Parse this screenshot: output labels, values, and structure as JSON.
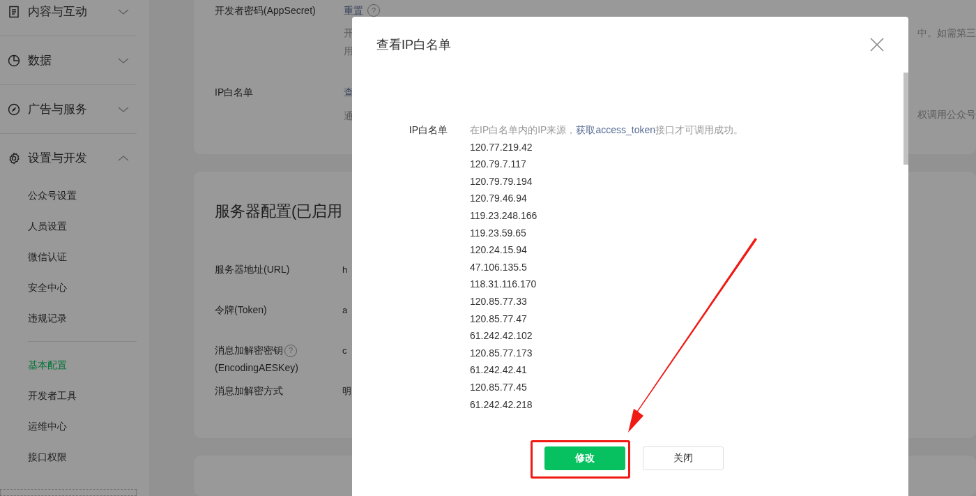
{
  "sidebar": {
    "sections": [
      {
        "label": "内容与互动",
        "expanded": false
      },
      {
        "label": "数据",
        "expanded": false
      },
      {
        "label": "广告与服务",
        "expanded": false
      },
      {
        "label": "设置与开发",
        "expanded": true,
        "children": [
          {
            "label": "公众号设置",
            "selected": false
          },
          {
            "label": "人员设置",
            "selected": false
          },
          {
            "label": "微信认证",
            "selected": false
          },
          {
            "label": "安全中心",
            "selected": false
          },
          {
            "label": "违规记录",
            "selected": false
          },
          {
            "label": "基本配置",
            "selected": true,
            "group_start": true
          },
          {
            "label": "开发者工具",
            "selected": false
          },
          {
            "label": "运维中心",
            "selected": false
          },
          {
            "label": "接口权限",
            "selected": false
          }
        ]
      }
    ]
  },
  "developer_card": {
    "rows": [
      {
        "label": "开发者密码(AppSecret)",
        "link": "重置",
        "help": "?",
        "description": [
          "开",
          "用"
        ],
        "description_tail": "中。如需第三"
      },
      {
        "label": "IP白名单",
        "link": "查",
        "description": [
          "通"
        ],
        "description_tail": "权调用公众号"
      }
    ]
  },
  "server_card": {
    "title": "服务器配置(已启用",
    "rows": [
      {
        "label": "服务器地址(URL)",
        "value": "h"
      },
      {
        "label": "令牌(Token)",
        "value": "a"
      },
      {
        "label": "消息加解密密钥",
        "sublabel": "(EncodingAESKey)",
        "help": "?",
        "value": "c"
      },
      {
        "label": "消息加解密方式",
        "value": "明"
      }
    ]
  },
  "dialog": {
    "title": "查看IP白名单",
    "field_label": "IP白名单",
    "hint": "在IP白名单内的IP来源，",
    "hint_link": "获取access_token",
    "hint_tail": "接口才可调用成功。",
    "ips": [
      "120.77.219.42",
      "120.79.7.117",
      "120.79.79.194",
      "120.79.46.94",
      "119.23.248.166",
      "119.23.59.65",
      "120.24.15.94",
      "47.106.135.5",
      "118.31.116.170",
      "120.85.77.33",
      "120.85.77.47",
      "61.242.42.102",
      "120.85.77.173",
      "61.242.42.41",
      "120.85.77.45",
      "61.242.42.218"
    ],
    "buttons": [
      {
        "label": "修改",
        "kind": "primary",
        "highlighted": true
      },
      {
        "label": "关闭",
        "kind": "default",
        "highlighted": false
      }
    ]
  }
}
